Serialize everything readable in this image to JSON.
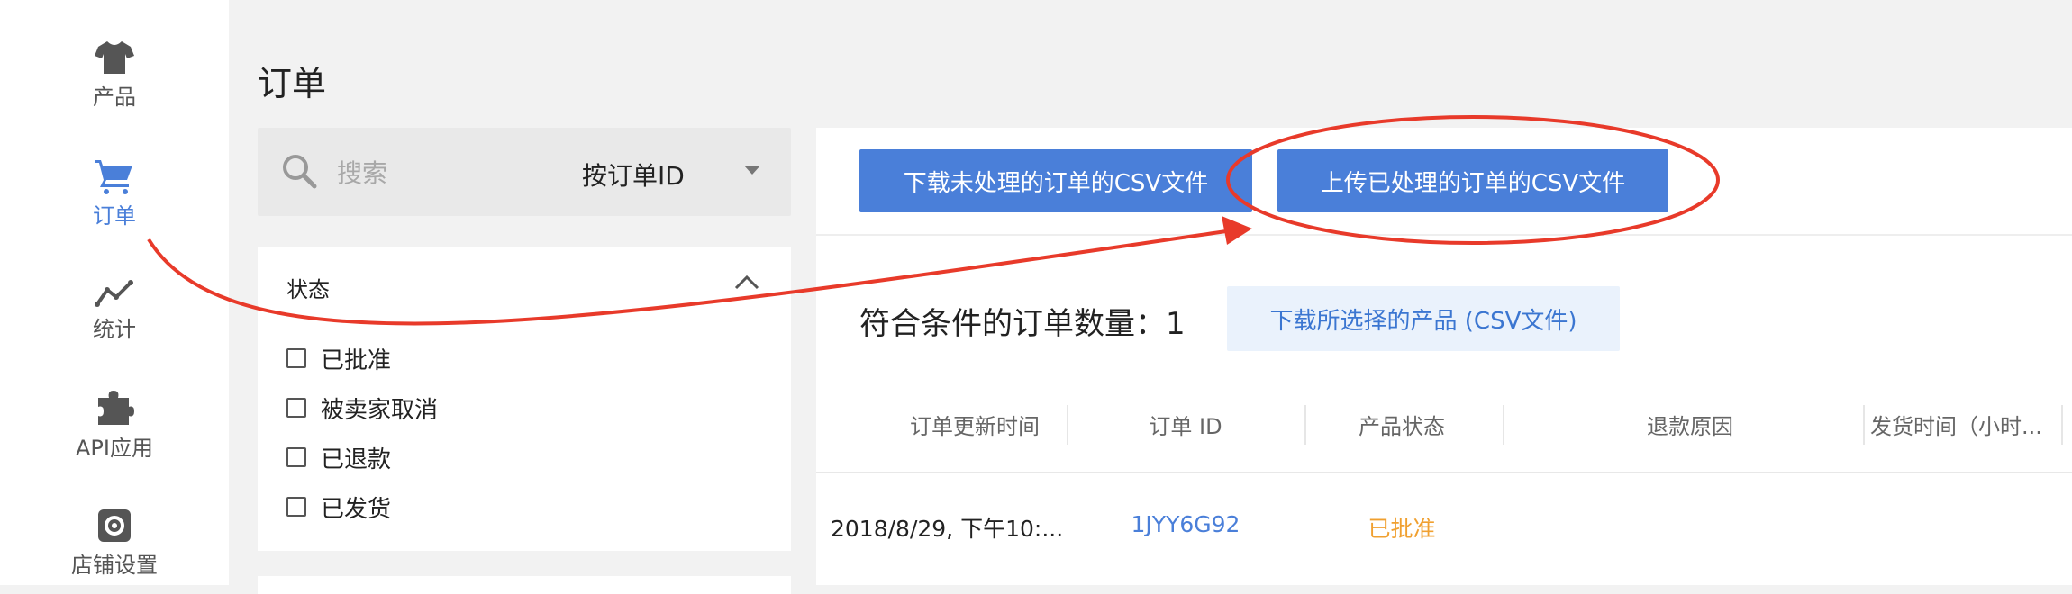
{
  "sidebar": {
    "items": [
      {
        "label": "产品",
        "icon": "tshirt-icon",
        "active": false
      },
      {
        "label": "订单",
        "icon": "cart-icon",
        "active": true
      },
      {
        "label": "统计",
        "icon": "chart-line-icon",
        "active": false
      },
      {
        "label": "API应用",
        "icon": "puzzle-icon",
        "active": false
      },
      {
        "label": "店铺设置",
        "icon": "gear-icon",
        "active": false
      }
    ]
  },
  "page": {
    "title": "订单"
  },
  "search": {
    "placeholder": "搜索",
    "value": "",
    "type_selected": "按订单ID"
  },
  "filter": {
    "title": "状态",
    "options": [
      {
        "label": "已批准",
        "checked": false
      },
      {
        "label": "被卖家取消",
        "checked": false
      },
      {
        "label": "已退款",
        "checked": false
      },
      {
        "label": "已发货",
        "checked": false
      }
    ]
  },
  "toolbar": {
    "download_label": "下载未处理的订单的CSV文件",
    "upload_label": "上传已处理的订单的CSV文件"
  },
  "results": {
    "count_text": "符合条件的订单数量：1",
    "download_selected_label": "下载所选择的产品 (CSV文件)"
  },
  "table": {
    "headers": [
      "订单更新时间",
      "订单 ID",
      "产品状态",
      "退款原因",
      "发货时间（小时..."
    ],
    "rows": [
      {
        "updated": "2018/8/29, 下午10:...",
        "order_id": "1JYY6G92",
        "status": "已批准",
        "refund_reason": "",
        "ship_time": ""
      }
    ]
  },
  "colors": {
    "accent": "#4a7fd9",
    "link": "#3b76d1",
    "status_approved": "#f0a030",
    "annotation": "#e83a2a"
  }
}
